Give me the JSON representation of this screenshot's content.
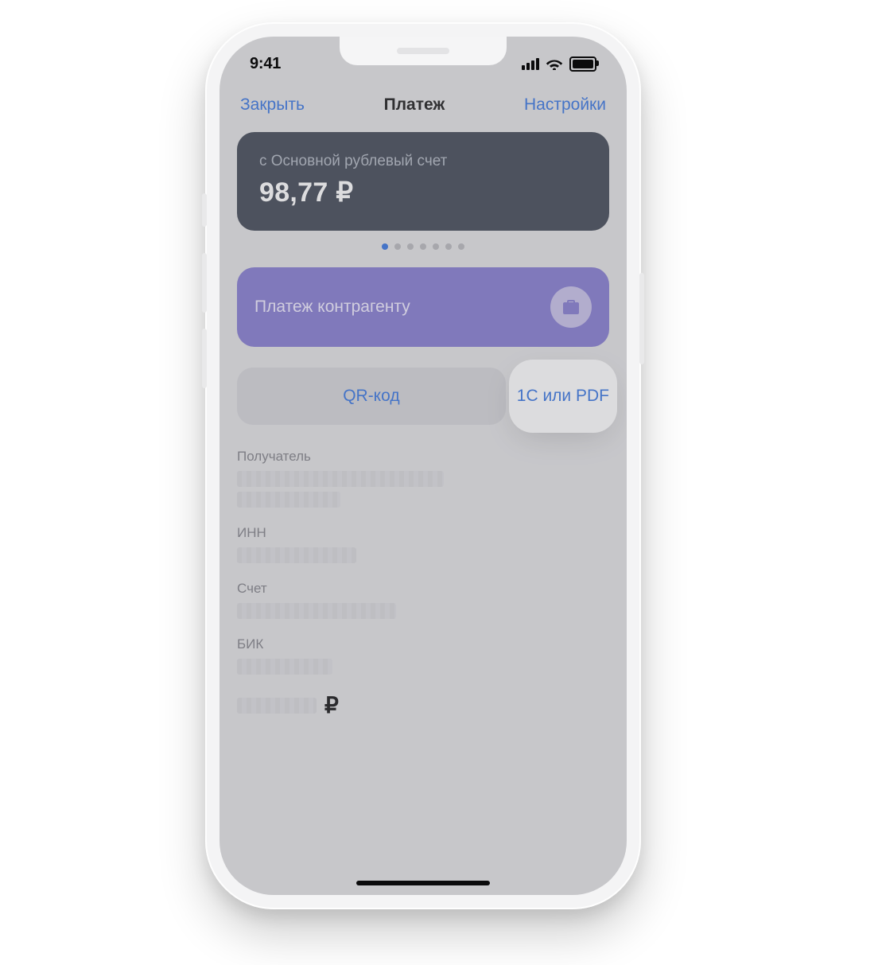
{
  "status": {
    "time": "9:41"
  },
  "nav": {
    "close": "Закрыть",
    "title": "Платеж",
    "settings": "Настройки"
  },
  "account": {
    "label": "с Основной рублевый счет",
    "balance": "98,77 ₽",
    "page_count": 7,
    "active_page": 0
  },
  "primary_action": {
    "label": "Платеж контрагенту",
    "icon": "briefcase-icon"
  },
  "buttons": {
    "qr": "QR-код",
    "pdf": "1С или PDF"
  },
  "form": {
    "recipient_label": "Получатель",
    "inn_label": "ИНН",
    "account_label": "Счет",
    "bik_label": "БИК",
    "currency_symbol": "₽"
  }
}
